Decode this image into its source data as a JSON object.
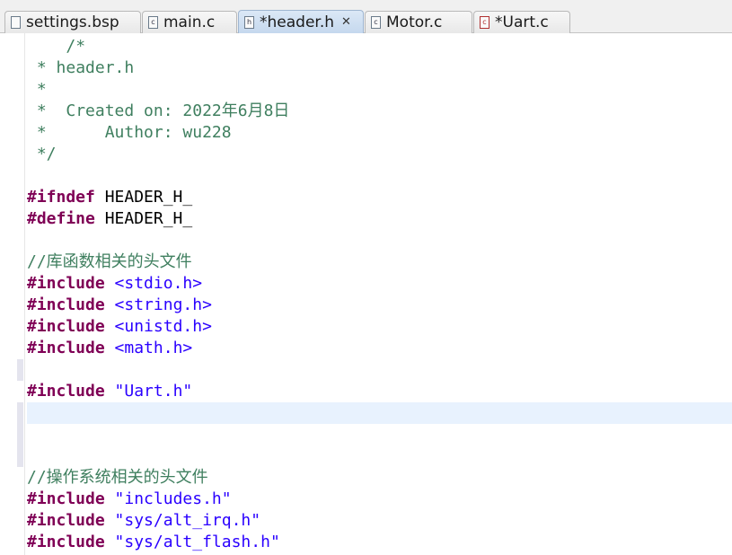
{
  "tabs": [
    {
      "label": "settings.bsp",
      "icon": "document-icon",
      "active": false
    },
    {
      "label": "main.c",
      "icon": "c-source-file-icon",
      "active": false
    },
    {
      "label": "*header.h",
      "icon": "header-file-icon",
      "active": true,
      "closable": true
    },
    {
      "label": "Motor.c",
      "icon": "c-source-file-icon",
      "active": false
    },
    {
      "label": "*Uart.c",
      "icon": "c-source-error-icon",
      "active": false
    }
  ],
  "close_icon": "close-icon",
  "colors": {
    "keyword": "#7f0055",
    "comment": "#3f7f5f",
    "string": "#2a00ff",
    "current_line": "#e8f2fe"
  },
  "editor": {
    "lines": [
      {
        "indent": "    ",
        "comment": "/*"
      },
      {
        "indent": " ",
        "comment": "* header.h"
      },
      {
        "indent": " ",
        "comment": "*"
      },
      {
        "indent": " ",
        "comment": "*  Created on: 2022年6月8日"
      },
      {
        "indent": " ",
        "comment": "*      Author: wu228"
      },
      {
        "indent": " ",
        "comment": "*/"
      },
      {},
      {
        "keyword": "#ifndef",
        "text": " HEADER_H_"
      },
      {
        "keyword": "#define",
        "text": " HEADER_H_"
      },
      {},
      {
        "comment": "//库函数相关的头文件"
      },
      {
        "keyword": "#include",
        "text": " ",
        "string": "<stdio.h>"
      },
      {
        "keyword": "#include",
        "text": " ",
        "string": "<string.h>"
      },
      {
        "keyword": "#include",
        "text": " ",
        "string": "<unistd.h>"
      },
      {
        "keyword": "#include",
        "text": " ",
        "string": "<math.h>"
      },
      {},
      {
        "keyword": "#include",
        "text": " ",
        "string": "\"Uart.h\""
      },
      {},
      {},
      {},
      {
        "comment": "//操作系统相关的头文件"
      },
      {
        "keyword": "#include",
        "text": " ",
        "string": "\"includes.h\""
      },
      {
        "keyword": "#include",
        "text": " ",
        "string": "\"sys/alt_irq.h\""
      },
      {
        "keyword": "#include",
        "text": " ",
        "string": "\"sys/alt_flash.h\""
      }
    ]
  }
}
